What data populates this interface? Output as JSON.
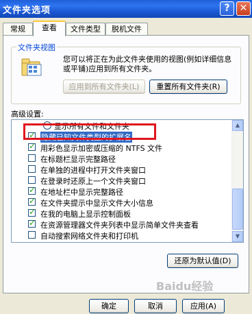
{
  "window": {
    "title": "文件夹选项",
    "help_glyph": "?",
    "close_glyph": "✕"
  },
  "tabs": [
    {
      "label": "常规"
    },
    {
      "label": "查看"
    },
    {
      "label": "文件类型"
    },
    {
      "label": "脱机文件"
    }
  ],
  "folder_views": {
    "legend": "文件夹视图",
    "description": "您可以将正在为此文件夹使用的视图(例如详细信息或平铺)应用到所有文件夹。",
    "apply_all_label": "应用到所有文件夹(L)",
    "reset_all_label": "重置所有文件夹(R)"
  },
  "advanced": {
    "label": "高级设置:",
    "items": [
      {
        "label": "显示所有文件和文件夹",
        "type": "radio",
        "checked": false
      },
      {
        "label": "隐藏已知文件类型的扩展名",
        "type": "checkbox",
        "checked": true
      },
      {
        "label": "用彩色显示加密或压缩的 NTFS 文件",
        "type": "checkbox",
        "checked": true
      },
      {
        "label": "在标题栏显示完整路径",
        "type": "checkbox",
        "checked": false
      },
      {
        "label": "在单独的进程中打开文件夹窗口",
        "type": "checkbox",
        "checked": false
      },
      {
        "label": "在登录时还原上一个文件夹窗口",
        "type": "checkbox",
        "checked": false
      },
      {
        "label": "在地址栏中显示完整路径",
        "type": "checkbox",
        "checked": true
      },
      {
        "label": "在文件夹提示中显示文件大小信息",
        "type": "checkbox",
        "checked": true
      },
      {
        "label": "在我的电脑上显示控制面板",
        "type": "checkbox",
        "checked": true
      },
      {
        "label": "在资源管理器文件夹列表中显示简单文件夹查看",
        "type": "checkbox",
        "checked": true
      },
      {
        "label": "自动搜索网络文件夹和打印机",
        "type": "checkbox",
        "checked": false
      }
    ],
    "restore_defaults_label": "还原为默认值(D)"
  },
  "footer": {
    "ok_label": "确定",
    "cancel_label": "取消",
    "apply_label": "应用(A)"
  },
  "watermark_text": "Baidu经验"
}
